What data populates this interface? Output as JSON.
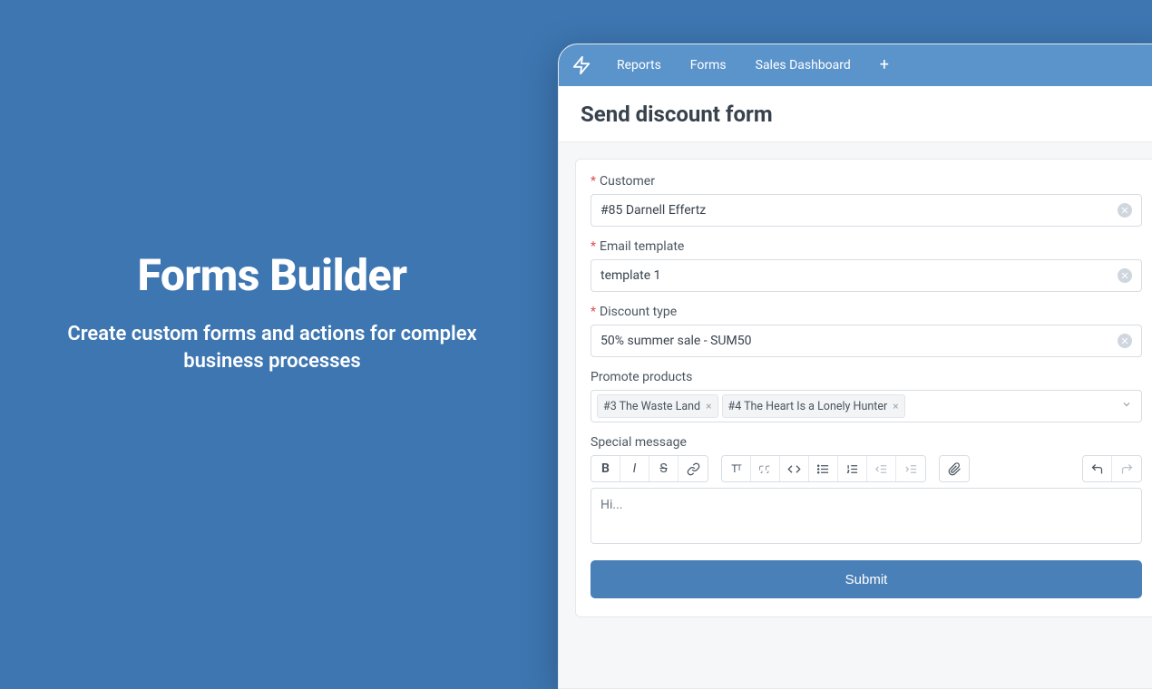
{
  "marketing": {
    "title": "Forms Builder",
    "subtitle": "Create custom forms and actions for complex business processes"
  },
  "tabs": [
    {
      "label": "Reports"
    },
    {
      "label": "Forms"
    },
    {
      "label": "Sales Dashboard"
    }
  ],
  "page_title": "Send discount form",
  "asterisk": "*",
  "form": {
    "customer": {
      "label": "Customer",
      "value": "#85 Darnell Effertz"
    },
    "email_template": {
      "label": "Email template",
      "value": "template 1"
    },
    "discount_type": {
      "label": "Discount type",
      "value": "50% summer sale - SUM50"
    },
    "promote_products": {
      "label": "Promote products",
      "tags": [
        "#3 The Waste Land",
        "#4 The Heart Is a Lonely Hunter"
      ]
    },
    "special_message": {
      "label": "Special message",
      "value": "Hi..."
    }
  },
  "submit_label": "Submit"
}
